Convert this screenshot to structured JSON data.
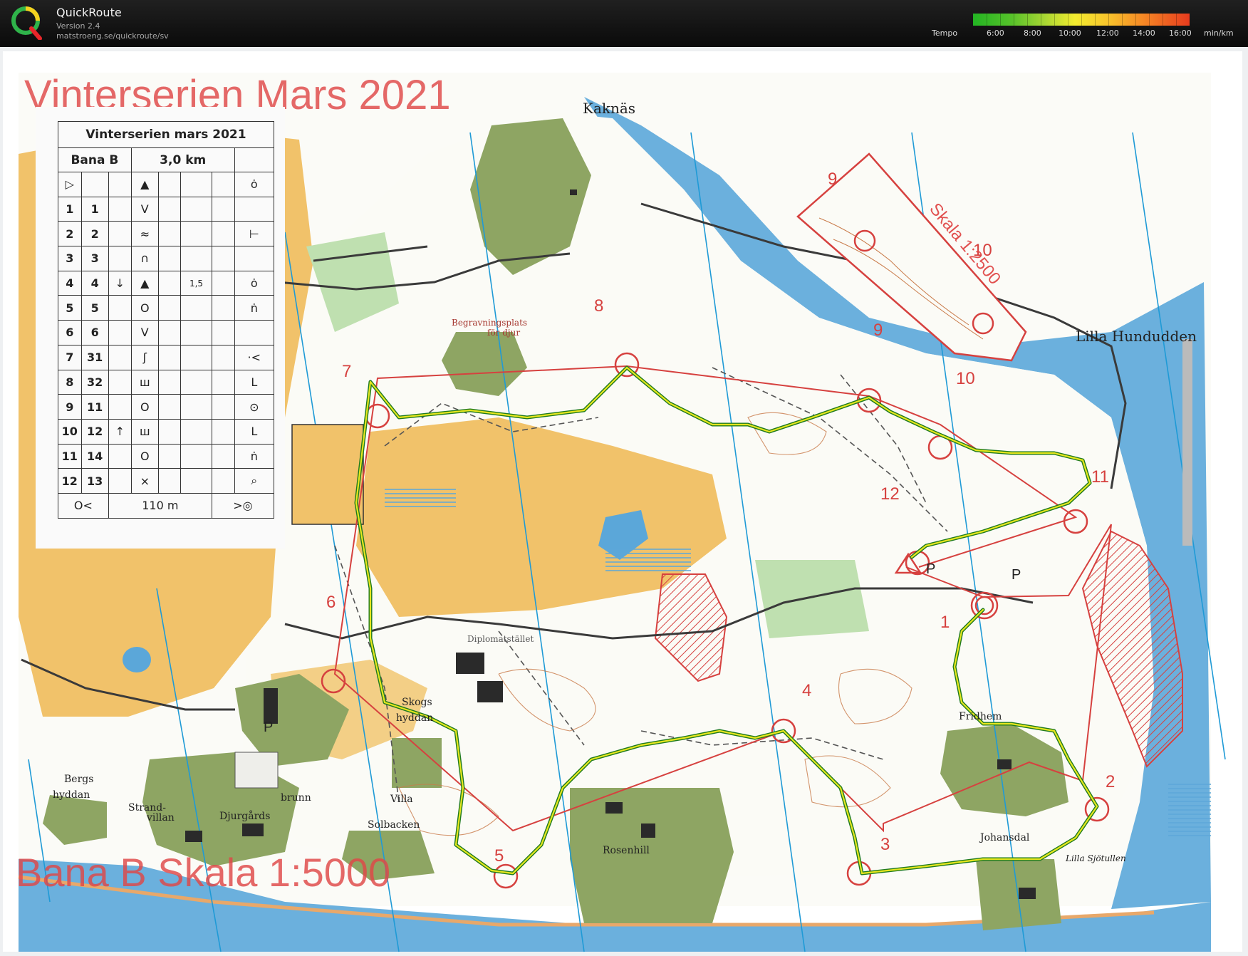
{
  "app": {
    "title": "QuickRoute",
    "version": "Version 2.4",
    "url": "matstroeng.se/quickroute/sv"
  },
  "legend": {
    "label": "Tempo",
    "ticks": [
      "6:00",
      "8:00",
      "10:00",
      "12:00",
      "14:00",
      "16:00"
    ],
    "unit": "min/km",
    "colors": [
      "#23b523",
      "#a8d633",
      "#f3ec2f",
      "#f68a25",
      "#e73b1e"
    ]
  },
  "map": {
    "title": "Vinterserien Mars 2021",
    "footer": "Bana B Skala 1:5000",
    "inset_scale": "Skala 1:2500",
    "place_names": {
      "kaknas": "Kaknäs",
      "lilla_hundudden": "Lilla Hundudden",
      "begravningsplats_1": "Begravningsplats",
      "begravningsplats_2": "för djur",
      "fridhem": "Fridhem",
      "johansdal": "Johansdal",
      "lilla_sjotullen": "Lilla Sjötullen",
      "rosenhill": "Rosenhill",
      "villa_solbacken_1": "Villa",
      "villa_solbacken_2": "Solbacken",
      "djurgards": "Djurgårds",
      "brunn": "brunn",
      "strandvillan_1": "Strand-",
      "strandvillan_2": "villan",
      "bergshyddan_1": "Bergs",
      "bergshyddan_2": "hyddan",
      "skogshyddan_1": "Skogs",
      "skogshyddan_2": "hyddan",
      "parking": "P",
      "diplomatstallet": "Diplomatstället"
    },
    "controls": {
      "c1": "1",
      "c2": "2",
      "c3": "3",
      "c4": "4",
      "c5": "5",
      "c6": "6",
      "c7": "7",
      "c8": "8",
      "c9": "9",
      "c10": "10",
      "c11": "11",
      "c12": "12",
      "inset9": "9",
      "inset10": "10"
    },
    "colors": {
      "forest_green": "#8ea563",
      "open_yellow": "#f1c26a",
      "water_blue": "#5ba7d9",
      "course_red": "#d6413f",
      "route_green": "#1f7a1f",
      "route_yellow": "#e6e61e"
    }
  },
  "description_sheet": {
    "title": "Vinterserien mars 2021",
    "course": "Bana B",
    "length": "3,0 km",
    "rows": [
      {
        "no": "1",
        "code": "1",
        "dir": "",
        "feature": "V",
        "size": "",
        "where": ""
      },
      {
        "no": "2",
        "code": "2",
        "dir": "",
        "feature": "≈",
        "size": "",
        "where": "⊢"
      },
      {
        "no": "3",
        "code": "3",
        "dir": "",
        "feature": "∩",
        "size": "",
        "where": ""
      },
      {
        "no": "4",
        "code": "4",
        "dir": "↓",
        "feature": "▲",
        "size": "1,5",
        "where": "ȯ"
      },
      {
        "no": "5",
        "code": "5",
        "dir": "",
        "feature": "O",
        "size": "",
        "where": "ṅ"
      },
      {
        "no": "6",
        "code": "6",
        "dir": "",
        "feature": "V",
        "size": "",
        "where": ""
      },
      {
        "no": "7",
        "code": "31",
        "dir": "",
        "feature": "ʃ",
        "size": "",
        "where": "·<"
      },
      {
        "no": "8",
        "code": "32",
        "dir": "",
        "feature": "ш",
        "size": "",
        "where": "L"
      },
      {
        "no": "9",
        "code": "11",
        "dir": "",
        "feature": "O",
        "size": "",
        "where": "⊙"
      },
      {
        "no": "10",
        "code": "12",
        "dir": "↑",
        "feature": "ш",
        "size": "",
        "where": "L"
      },
      {
        "no": "11",
        "code": "14",
        "dir": "",
        "feature": "O",
        "size": "",
        "where": "ṅ"
      },
      {
        "no": "12",
        "code": "13",
        "dir": "",
        "feature": "×",
        "size": "",
        "where": "⌕"
      }
    ],
    "start": {
      "triangle": "▷",
      "feature": "▲",
      "where": "ȯ"
    },
    "finish": {
      "distance": "110 m",
      "left": "O<",
      "right": ">◎"
    }
  }
}
